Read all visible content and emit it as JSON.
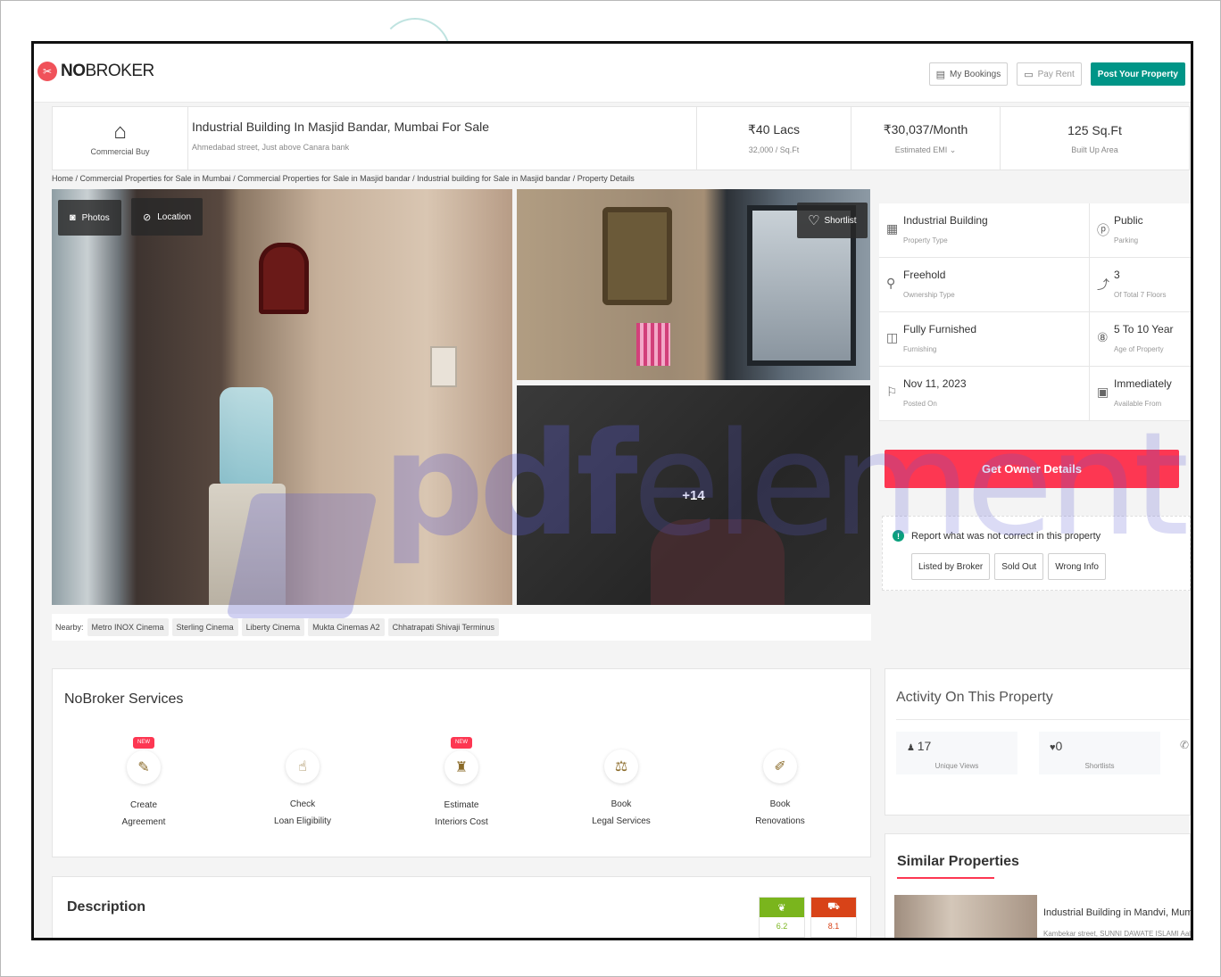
{
  "header": {
    "logo_bold": "NO",
    "logo_light": "BROKER",
    "buttons": {
      "my_bookings": "My Bookings",
      "pay_rent": "Pay Rent",
      "post_property": "Post Your Property"
    }
  },
  "listing": {
    "category_label": "Commercial Buy",
    "title": "Industrial Building In Masjid Bandar, Mumbai For Sale",
    "address": "Ahmedabad street, Just above Canara bank",
    "price": "₹40 Lacs",
    "price_per_sqft": "32,000 / Sq.Ft",
    "emi": "₹30,037/Month",
    "emi_label": "Estimated EMI ⌄",
    "area": "125 Sq.Ft",
    "area_label": "Built Up Area"
  },
  "breadcrumb": "Home / Commercial Properties for Sale in Mumbai / Commercial Properties for Sale in Masjid bandar / Industrial building for Sale in Masjid bandar / Property Details",
  "gallery": {
    "photos_label": "Photos",
    "location_label": "Location",
    "shortlist_label": "Shortlist",
    "more_count": "+14"
  },
  "nearby": {
    "label": "Nearby:",
    "places": [
      "Metro INOX Cinema",
      "Sterling Cinema",
      "Liberty Cinema",
      "Mukta Cinemas A2",
      "Chhatrapati Shivaji Terminus"
    ]
  },
  "details": [
    {
      "value": "Industrial Building",
      "label": "Property Type",
      "icon": "building-icon"
    },
    {
      "value": "Public",
      "label": "Parking",
      "icon": "parking-icon"
    },
    {
      "value": "Freehold",
      "label": "Ownership Type",
      "icon": "key-icon"
    },
    {
      "value": "3",
      "label": "Of Total 7 Floors",
      "icon": "stairs-icon"
    },
    {
      "value": "Fully Furnished",
      "label": "Furnishing",
      "icon": "wardrobe-icon"
    },
    {
      "value": "5 To 10 Year",
      "label": "Age of Property",
      "icon": "age-icon"
    },
    {
      "value": "Nov 11, 2023",
      "label": "Posted On",
      "icon": "flag-icon"
    },
    {
      "value": "Immediately",
      "label": "Available From",
      "icon": "calendar-icon"
    }
  ],
  "owner_button": "Get Owner Details",
  "report": {
    "title": "Report what was not correct in this property",
    "icon_glyph": "!",
    "options": [
      "Listed by Broker",
      "Sold Out",
      "Wrong Info"
    ]
  },
  "services": {
    "title": "NoBroker Services",
    "new_badge": "NEW",
    "items": [
      {
        "line1": "Create",
        "line2": "Agreement",
        "new": true,
        "icon": "agreement-icon"
      },
      {
        "line1": "Check",
        "line2": "Loan Eligibility",
        "new": false,
        "icon": "loan-icon"
      },
      {
        "line1": "Estimate",
        "line2": "Interiors Cost",
        "new": true,
        "icon": "interiors-icon"
      },
      {
        "line1": "Book",
        "line2": "Legal Services",
        "new": false,
        "icon": "legal-icon"
      },
      {
        "line1": "Book",
        "line2": "Renovations",
        "new": false,
        "icon": "renovation-icon"
      }
    ]
  },
  "activity": {
    "title": "Activity On This Property",
    "unique_views": "17",
    "unique_views_label": "Unique Views",
    "shortlists": "0",
    "shortlists_label": "Shortlists"
  },
  "similar": {
    "title": "Similar Properties",
    "property_title": "Industrial Building in Mandvi, Mumbai f",
    "property_sub": "Kambekar street, SUNNI DAWATE ISLAMI Aalmi Marka"
  },
  "description": {
    "title": "Description",
    "score_green": "6.2",
    "score_red": "8.1"
  },
  "watermark": {
    "pdf": "pdf",
    "element": "element"
  },
  "colors": {
    "accent_red": "#fd3752",
    "post_green": "#009587",
    "brand_red": "#f0525a"
  }
}
